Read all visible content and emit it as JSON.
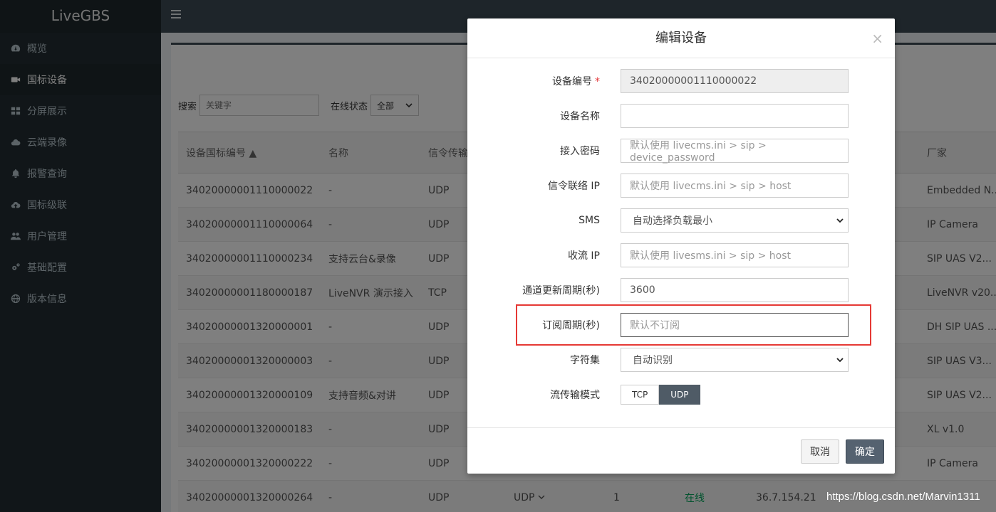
{
  "app": {
    "brand": "LiveGBS"
  },
  "sidebar": {
    "items": [
      {
        "label": "概览",
        "icon": "dashboard-icon"
      },
      {
        "label": "国标设备",
        "icon": "camera-icon",
        "active": true
      },
      {
        "label": "分屏展示",
        "icon": "grid-icon"
      },
      {
        "label": "云端录像",
        "icon": "cloud-icon"
      },
      {
        "label": "报警查询",
        "icon": "bell-icon"
      },
      {
        "label": "国标级联",
        "icon": "cloud-upload-icon"
      },
      {
        "label": "用户管理",
        "icon": "users-icon"
      },
      {
        "label": "基础配置",
        "icon": "gears-icon"
      },
      {
        "label": "版本信息",
        "icon": "globe-icon"
      }
    ]
  },
  "filter": {
    "search_label": "搜索",
    "search_placeholder": "关键字",
    "status_label": "在线状态",
    "status_value": "全部"
  },
  "table": {
    "headers": [
      "设备国标编号",
      "名称",
      "信令传输",
      "",
      "",
      "",
      "",
      "厂家"
    ],
    "rows": [
      {
        "id": "34020000001110000022",
        "name": "-",
        "transport": "UDP",
        "vendor": "Embedded N..."
      },
      {
        "id": "34020000001110000064",
        "name": "-",
        "transport": "UDP",
        "vendor": "IP Camera"
      },
      {
        "id": "34020000001110000234",
        "name": "支持云台&录像",
        "transport": "UDP",
        "vendor": "SIP UAS V2..."
      },
      {
        "id": "34020000001180000187",
        "name": "LiveNVR 演示接入",
        "transport": "TCP",
        "vendor": "LiveNVR v20..."
      },
      {
        "id": "34020000001320000001",
        "name": "-",
        "transport": "UDP",
        "vendor": "DH SIP UAS ..."
      },
      {
        "id": "34020000001320000003",
        "name": "-",
        "transport": "UDP",
        "vendor": "SIP UAS V3..."
      },
      {
        "id": "34020000001320000109",
        "name": "支持音频&对讲",
        "transport": "UDP",
        "vendor": "SIP UAS V2..."
      },
      {
        "id": "34020000001320000183",
        "name": "-",
        "transport": "UDP",
        "vendor": "XL v1.0"
      },
      {
        "id": "34020000001320000222",
        "name": "-",
        "transport": "UDP",
        "vendor": "IP Camera"
      },
      {
        "id": "34020000001320000264",
        "name": "-",
        "transport": "UDP",
        "stream": "UDP",
        "channels": "1",
        "status": "在线",
        "ip": "36.7.154.21",
        "vendor": ""
      }
    ]
  },
  "modal": {
    "title": "编辑设备",
    "close": "×",
    "fields": {
      "device_id_label": "设备编号",
      "device_id_required": "*",
      "device_id_value": "34020000001110000022",
      "device_name_label": "设备名称",
      "password_label": "接入密码",
      "password_placeholder": "默认使用 livecms.ini > sip > device_password",
      "signal_ip_label": "信令联络 IP",
      "signal_ip_placeholder": "默认使用 livecms.ini > sip > host",
      "sms_label": "SMS",
      "sms_value": "自动选择负载最小",
      "recv_ip_label": "收流 IP",
      "recv_ip_placeholder": "默认使用 livesms.ini > sip > host",
      "channel_period_label": "通道更新周期(秒)",
      "channel_period_value": "3600",
      "subscribe_label": "订阅周期(秒)",
      "subscribe_placeholder": "默认不订阅",
      "charset_label": "字符集",
      "charset_value": "自动识别",
      "stream_mode_label": "流传输模式",
      "stream_tcp": "TCP",
      "stream_udp": "UDP"
    },
    "cancel": "取消",
    "ok": "确定"
  },
  "watermark": "https://blog.csdn.net/Marvin1311"
}
